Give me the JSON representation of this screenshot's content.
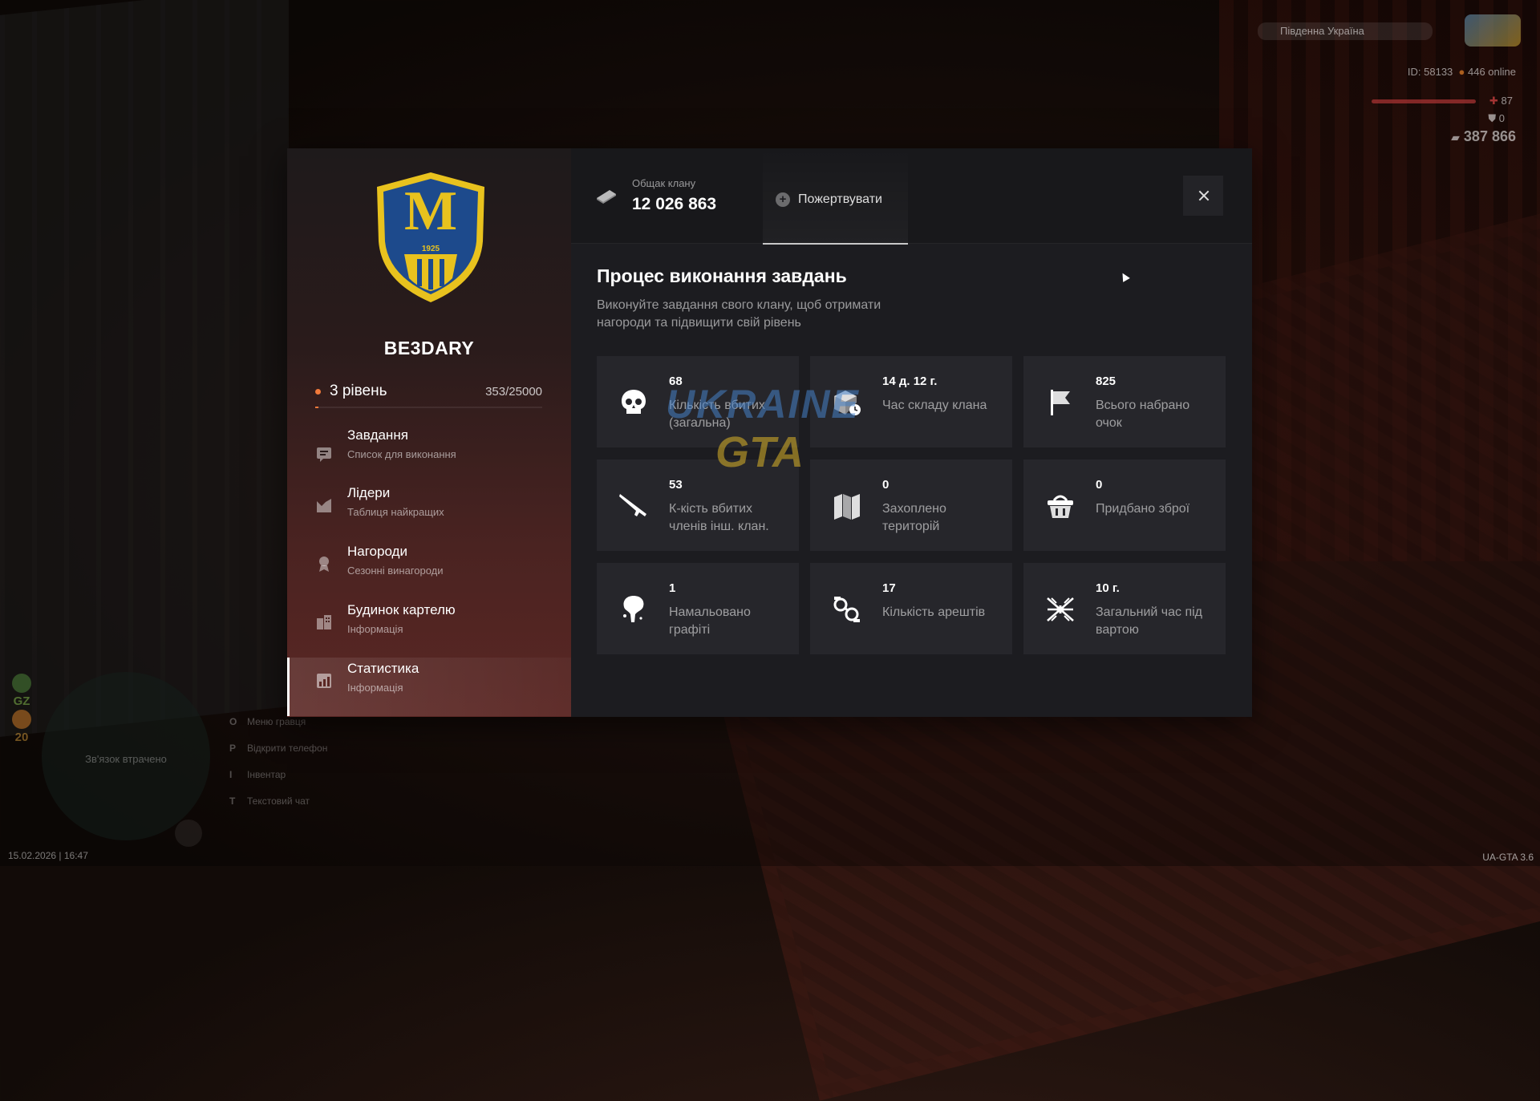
{
  "hud": {
    "region": "Південна Україна",
    "id_text": "ID: 58133",
    "online": "446 online",
    "health": "87",
    "armor": "0",
    "money": "387 866"
  },
  "bottom_hud": {
    "badge_1": "GZ",
    "badge_2": "20",
    "radar_lost": "Зв'язок втрачено",
    "hints": [
      {
        "key": "O",
        "label": "Меню гравця"
      },
      {
        "key": "P",
        "label": "Відкрити телефон"
      },
      {
        "key": "I",
        "label": "Інвентар"
      },
      {
        "key": "T",
        "label": "Текстовий чат"
      }
    ],
    "timestamp": "15.02.2026 | 16:47",
    "version": "UA-GTA 3.6"
  },
  "clan": {
    "crest_letter": "M",
    "crest_year": "1925",
    "name": "BE3DARY",
    "level": "3 рівень",
    "xp": "353/25000",
    "xp_fraction": 0.014
  },
  "menu": [
    {
      "title": "Завдання",
      "subtitle": "Список для виконання",
      "icon": "list-icon"
    },
    {
      "title": "Лідери",
      "subtitle": "Таблиця найкращих",
      "icon": "chart-icon"
    },
    {
      "title": "Нагороди",
      "subtitle": "Сезонні винагороди",
      "icon": "medal-icon"
    },
    {
      "title": "Будинок картелю",
      "subtitle": "Інформація",
      "icon": "building-icon"
    },
    {
      "title": "Статистика",
      "subtitle": "Інформація",
      "icon": "stats-icon"
    }
  ],
  "active_menu": "Статистика",
  "treasury": {
    "label": "Общак клану",
    "value": "12 026 863",
    "donate_label": "Пожертвувати"
  },
  "section": {
    "title": "Процес виконання завдань",
    "description": "Виконуйте завдання свого клану, щоб отримати нагороди та підвищити свій рівень"
  },
  "stats": [
    {
      "value": "68",
      "label": "Кількість вбитих (загальна)",
      "icon": "skull-icon"
    },
    {
      "value": "14 д. 12 г.",
      "label": "Час складу клана",
      "icon": "box-timer-icon"
    },
    {
      "value": "825",
      "label": "Всього набрано очок",
      "icon": "flag-icon"
    },
    {
      "value": "53",
      "label": "К-кість вбитих членів інш. клан.",
      "icon": "rifle-icon"
    },
    {
      "value": "0",
      "label": "Захоплено територій",
      "icon": "map-icon"
    },
    {
      "value": "0",
      "label": "Придбано зброї",
      "icon": "basket-icon"
    },
    {
      "value": "1",
      "label": "Намальовано графіті",
      "icon": "spray-icon"
    },
    {
      "value": "17",
      "label": "Кількість арештів",
      "icon": "handcuffs-icon"
    },
    {
      "value": "10 г.",
      "label": "Загальний час під вартою",
      "icon": "barbed-wire-icon"
    }
  ],
  "watermark": {
    "line1": "UKRAINE",
    "line2": "GTA"
  }
}
